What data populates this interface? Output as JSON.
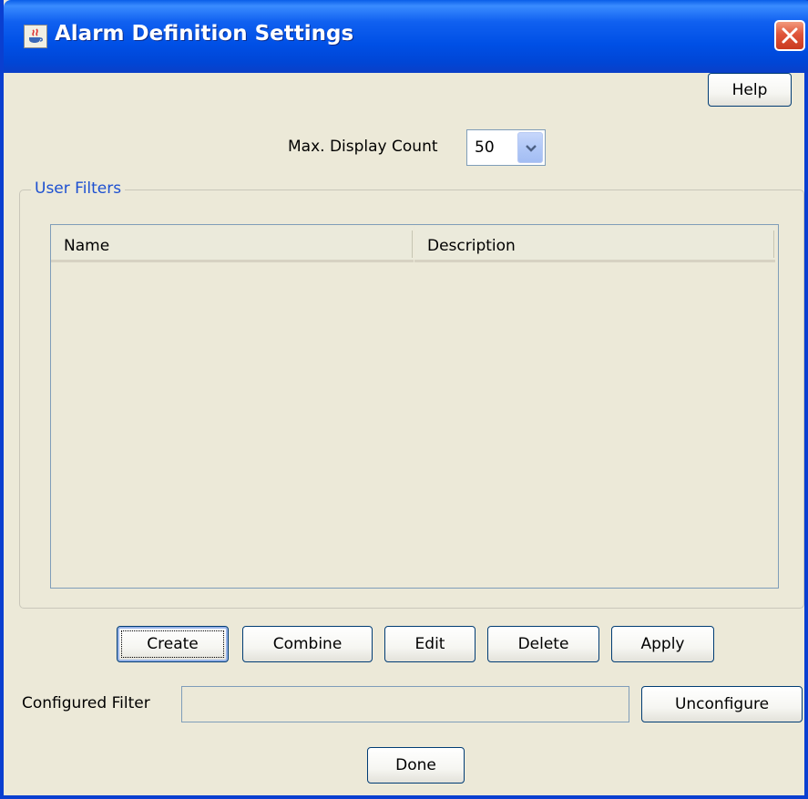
{
  "window": {
    "title": "Alarm Definition Settings"
  },
  "toolbar": {
    "help_label": "Help"
  },
  "display": {
    "max_count_label": "Max. Display Count",
    "max_count_value": "50"
  },
  "user_filters": {
    "title": "User Filters",
    "columns": [
      "Name",
      "Description"
    ],
    "rows": []
  },
  "actions": {
    "create": "Create",
    "combine": "Combine",
    "edit": "Edit",
    "delete": "Delete",
    "apply": "Apply"
  },
  "configured_filter": {
    "label": "Configured Filter",
    "value": "",
    "unconfigure_label": "Unconfigure"
  },
  "footer": {
    "done_label": "Done"
  },
  "colors": {
    "titlebar": "#0054e3",
    "close": "#e0553a",
    "group_title": "#1d50d1",
    "background": "#ece9d8"
  }
}
